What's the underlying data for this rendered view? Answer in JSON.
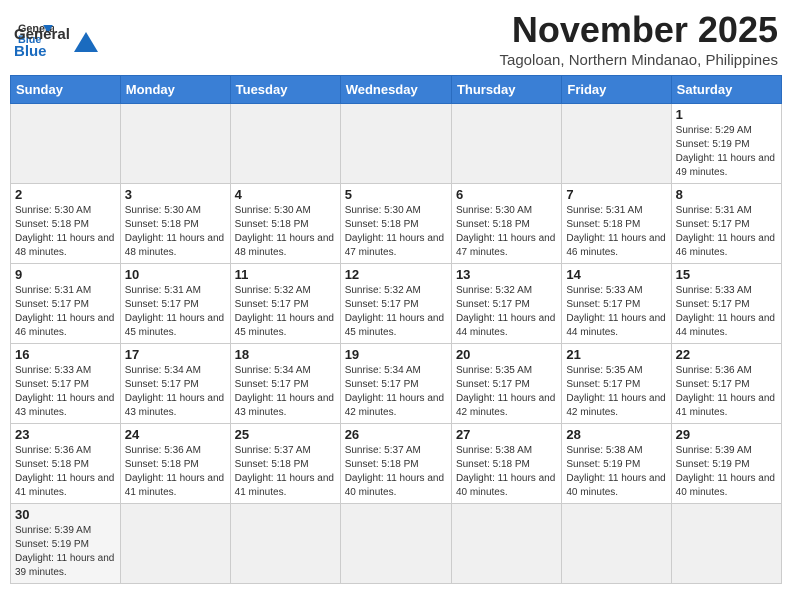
{
  "header": {
    "logo_general": "General",
    "logo_blue": "Blue",
    "title": "November 2025",
    "subtitle": "Tagoloan, Northern Mindanao, Philippines"
  },
  "weekdays": [
    "Sunday",
    "Monday",
    "Tuesday",
    "Wednesday",
    "Thursday",
    "Friday",
    "Saturday"
  ],
  "days": [
    {
      "num": "",
      "empty": true,
      "sunrise": "",
      "sunset": "",
      "daylight": ""
    },
    {
      "num": "",
      "empty": true,
      "sunrise": "",
      "sunset": "",
      "daylight": ""
    },
    {
      "num": "",
      "empty": true,
      "sunrise": "",
      "sunset": "",
      "daylight": ""
    },
    {
      "num": "",
      "empty": true,
      "sunrise": "",
      "sunset": "",
      "daylight": ""
    },
    {
      "num": "",
      "empty": true,
      "sunrise": "",
      "sunset": "",
      "daylight": ""
    },
    {
      "num": "",
      "empty": true,
      "sunrise": "",
      "sunset": "",
      "daylight": ""
    },
    {
      "num": "1",
      "empty": false,
      "sunrise": "Sunrise: 5:29 AM",
      "sunset": "Sunset: 5:19 PM",
      "daylight": "Daylight: 11 hours and 49 minutes."
    },
    {
      "num": "2",
      "empty": false,
      "sunrise": "Sunrise: 5:30 AM",
      "sunset": "Sunset: 5:18 PM",
      "daylight": "Daylight: 11 hours and 48 minutes."
    },
    {
      "num": "3",
      "empty": false,
      "sunrise": "Sunrise: 5:30 AM",
      "sunset": "Sunset: 5:18 PM",
      "daylight": "Daylight: 11 hours and 48 minutes."
    },
    {
      "num": "4",
      "empty": false,
      "sunrise": "Sunrise: 5:30 AM",
      "sunset": "Sunset: 5:18 PM",
      "daylight": "Daylight: 11 hours and 48 minutes."
    },
    {
      "num": "5",
      "empty": false,
      "sunrise": "Sunrise: 5:30 AM",
      "sunset": "Sunset: 5:18 PM",
      "daylight": "Daylight: 11 hours and 47 minutes."
    },
    {
      "num": "6",
      "empty": false,
      "sunrise": "Sunrise: 5:30 AM",
      "sunset": "Sunset: 5:18 PM",
      "daylight": "Daylight: 11 hours and 47 minutes."
    },
    {
      "num": "7",
      "empty": false,
      "sunrise": "Sunrise: 5:31 AM",
      "sunset": "Sunset: 5:18 PM",
      "daylight": "Daylight: 11 hours and 46 minutes."
    },
    {
      "num": "8",
      "empty": false,
      "sunrise": "Sunrise: 5:31 AM",
      "sunset": "Sunset: 5:17 PM",
      "daylight": "Daylight: 11 hours and 46 minutes."
    },
    {
      "num": "9",
      "empty": false,
      "sunrise": "Sunrise: 5:31 AM",
      "sunset": "Sunset: 5:17 PM",
      "daylight": "Daylight: 11 hours and 46 minutes."
    },
    {
      "num": "10",
      "empty": false,
      "sunrise": "Sunrise: 5:31 AM",
      "sunset": "Sunset: 5:17 PM",
      "daylight": "Daylight: 11 hours and 45 minutes."
    },
    {
      "num": "11",
      "empty": false,
      "sunrise": "Sunrise: 5:32 AM",
      "sunset": "Sunset: 5:17 PM",
      "daylight": "Daylight: 11 hours and 45 minutes."
    },
    {
      "num": "12",
      "empty": false,
      "sunrise": "Sunrise: 5:32 AM",
      "sunset": "Sunset: 5:17 PM",
      "daylight": "Daylight: 11 hours and 45 minutes."
    },
    {
      "num": "13",
      "empty": false,
      "sunrise": "Sunrise: 5:32 AM",
      "sunset": "Sunset: 5:17 PM",
      "daylight": "Daylight: 11 hours and 44 minutes."
    },
    {
      "num": "14",
      "empty": false,
      "sunrise": "Sunrise: 5:33 AM",
      "sunset": "Sunset: 5:17 PM",
      "daylight": "Daylight: 11 hours and 44 minutes."
    },
    {
      "num": "15",
      "empty": false,
      "sunrise": "Sunrise: 5:33 AM",
      "sunset": "Sunset: 5:17 PM",
      "daylight": "Daylight: 11 hours and 44 minutes."
    },
    {
      "num": "16",
      "empty": false,
      "sunrise": "Sunrise: 5:33 AM",
      "sunset": "Sunset: 5:17 PM",
      "daylight": "Daylight: 11 hours and 43 minutes."
    },
    {
      "num": "17",
      "empty": false,
      "sunrise": "Sunrise: 5:34 AM",
      "sunset": "Sunset: 5:17 PM",
      "daylight": "Daylight: 11 hours and 43 minutes."
    },
    {
      "num": "18",
      "empty": false,
      "sunrise": "Sunrise: 5:34 AM",
      "sunset": "Sunset: 5:17 PM",
      "daylight": "Daylight: 11 hours and 43 minutes."
    },
    {
      "num": "19",
      "empty": false,
      "sunrise": "Sunrise: 5:34 AM",
      "sunset": "Sunset: 5:17 PM",
      "daylight": "Daylight: 11 hours and 42 minutes."
    },
    {
      "num": "20",
      "empty": false,
      "sunrise": "Sunrise: 5:35 AM",
      "sunset": "Sunset: 5:17 PM",
      "daylight": "Daylight: 11 hours and 42 minutes."
    },
    {
      "num": "21",
      "empty": false,
      "sunrise": "Sunrise: 5:35 AM",
      "sunset": "Sunset: 5:17 PM",
      "daylight": "Daylight: 11 hours and 42 minutes."
    },
    {
      "num": "22",
      "empty": false,
      "sunrise": "Sunrise: 5:36 AM",
      "sunset": "Sunset: 5:17 PM",
      "daylight": "Daylight: 11 hours and 41 minutes."
    },
    {
      "num": "23",
      "empty": false,
      "sunrise": "Sunrise: 5:36 AM",
      "sunset": "Sunset: 5:18 PM",
      "daylight": "Daylight: 11 hours and 41 minutes."
    },
    {
      "num": "24",
      "empty": false,
      "sunrise": "Sunrise: 5:36 AM",
      "sunset": "Sunset: 5:18 PM",
      "daylight": "Daylight: 11 hours and 41 minutes."
    },
    {
      "num": "25",
      "empty": false,
      "sunrise": "Sunrise: 5:37 AM",
      "sunset": "Sunset: 5:18 PM",
      "daylight": "Daylight: 11 hours and 41 minutes."
    },
    {
      "num": "26",
      "empty": false,
      "sunrise": "Sunrise: 5:37 AM",
      "sunset": "Sunset: 5:18 PM",
      "daylight": "Daylight: 11 hours and 40 minutes."
    },
    {
      "num": "27",
      "empty": false,
      "sunrise": "Sunrise: 5:38 AM",
      "sunset": "Sunset: 5:18 PM",
      "daylight": "Daylight: 11 hours and 40 minutes."
    },
    {
      "num": "28",
      "empty": false,
      "sunrise": "Sunrise: 5:38 AM",
      "sunset": "Sunset: 5:19 PM",
      "daylight": "Daylight: 11 hours and 40 minutes."
    },
    {
      "num": "29",
      "empty": false,
      "sunrise": "Sunrise: 5:39 AM",
      "sunset": "Sunset: 5:19 PM",
      "daylight": "Daylight: 11 hours and 40 minutes."
    },
    {
      "num": "30",
      "empty": false,
      "sunrise": "Sunrise: 5:39 AM",
      "sunset": "Sunset: 5:19 PM",
      "daylight": "Daylight: 11 hours and 39 minutes."
    }
  ]
}
